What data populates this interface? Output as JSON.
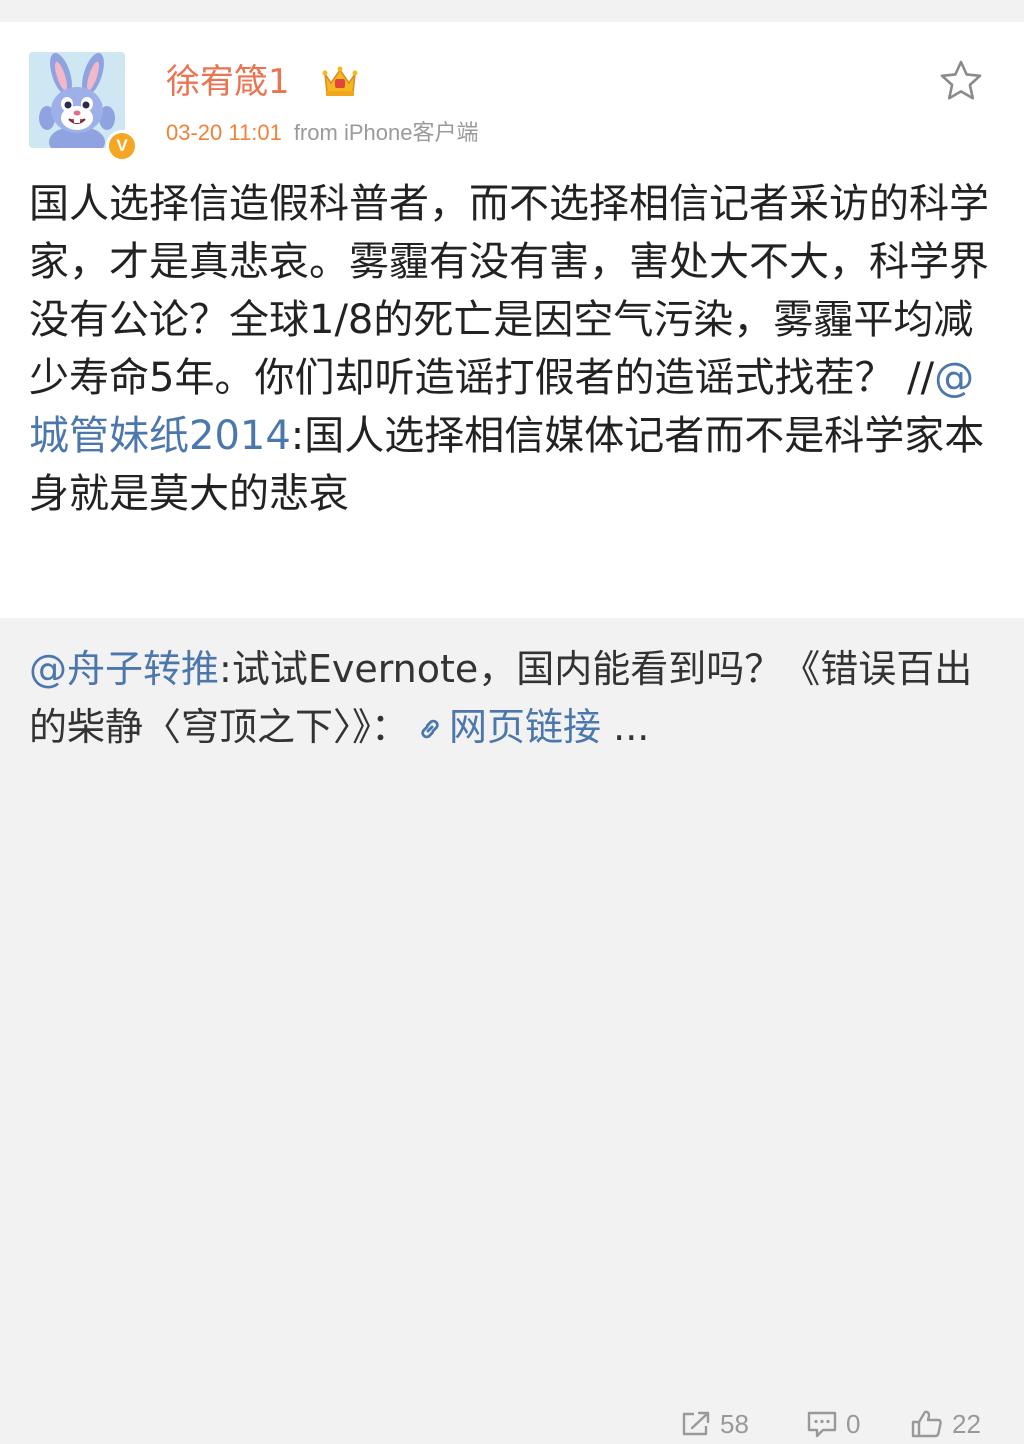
{
  "post": {
    "username": "徐宥箴1",
    "time": "03-20 11:01",
    "from_label": "from",
    "client": "iPhone客户端",
    "verified_badge": "V",
    "text_before_mention": "国人选择信造假科普者，而不选择相信记者采访的科学家，才是真悲哀。雾霾有没有害，害处大不大，科学界没有公论？全球1/8的死亡是因空气污染，雾霾平均减少寿命5年。你们却听造谣打假者的造谣式找茬？ //",
    "mention": "@城管妹纸2014",
    "text_after_mention": ":国人选择相信媒体记者而不是科学家本身就是莫大的悲哀"
  },
  "repost": {
    "mention": "@舟子转推",
    "text": ":试试Evernote，国内能看到吗？《错误百出的柴静〈穹顶之下〉》：",
    "link_label": "网页链接",
    "ellipsis": " ..."
  },
  "actions": {
    "repost_count": "58",
    "comment_count": "0",
    "like_count": "22"
  },
  "icons": {
    "avatar": "cartoon-rabbit-avatar",
    "badge": "verified-badge",
    "crown": "vip-crown-icon",
    "star": "star-icon",
    "link": "link-icon",
    "repost": "repost-icon",
    "comment": "comment-icon",
    "like": "thumbs-up-icon"
  },
  "colors": {
    "username": "#eb7350",
    "time": "#f0833a",
    "link": "#4b77ac",
    "badge": "#f5a623",
    "muted": "#999999"
  }
}
